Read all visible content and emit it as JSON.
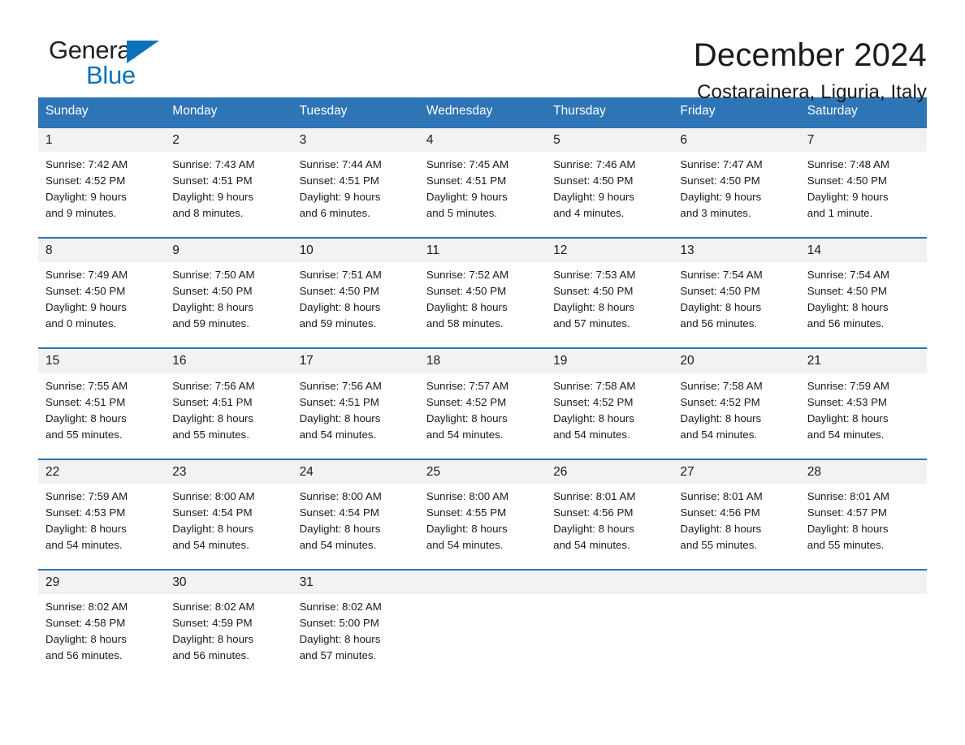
{
  "brand": {
    "logo_text_primary": "General",
    "logo_text_secondary": "Blue",
    "triangle_icon": "blue-triangle-icon",
    "accent_color": "#0d72b9"
  },
  "header": {
    "title": "December 2024",
    "subtitle": "Costarainera, Liguria, Italy"
  },
  "colors": {
    "header_blue": "#2e75b6",
    "daynum_band": "#f2f2f2",
    "text": "#1a1a1a"
  },
  "calendar": {
    "weekday_headers": [
      "Sunday",
      "Monday",
      "Tuesday",
      "Wednesday",
      "Thursday",
      "Friday",
      "Saturday"
    ],
    "weeks": [
      {
        "days": [
          {
            "num": "1",
            "sunrise": "Sunrise: 7:42 AM",
            "sunset": "Sunset: 4:52 PM",
            "daylight1": "Daylight: 9 hours",
            "daylight2": "and 9 minutes."
          },
          {
            "num": "2",
            "sunrise": "Sunrise: 7:43 AM",
            "sunset": "Sunset: 4:51 PM",
            "daylight1": "Daylight: 9 hours",
            "daylight2": "and 8 minutes."
          },
          {
            "num": "3",
            "sunrise": "Sunrise: 7:44 AM",
            "sunset": "Sunset: 4:51 PM",
            "daylight1": "Daylight: 9 hours",
            "daylight2": "and 6 minutes."
          },
          {
            "num": "4",
            "sunrise": "Sunrise: 7:45 AM",
            "sunset": "Sunset: 4:51 PM",
            "daylight1": "Daylight: 9 hours",
            "daylight2": "and 5 minutes."
          },
          {
            "num": "5",
            "sunrise": "Sunrise: 7:46 AM",
            "sunset": "Sunset: 4:50 PM",
            "daylight1": "Daylight: 9 hours",
            "daylight2": "and 4 minutes."
          },
          {
            "num": "6",
            "sunrise": "Sunrise: 7:47 AM",
            "sunset": "Sunset: 4:50 PM",
            "daylight1": "Daylight: 9 hours",
            "daylight2": "and 3 minutes."
          },
          {
            "num": "7",
            "sunrise": "Sunrise: 7:48 AM",
            "sunset": "Sunset: 4:50 PM",
            "daylight1": "Daylight: 9 hours",
            "daylight2": "and 1 minute."
          }
        ]
      },
      {
        "days": [
          {
            "num": "8",
            "sunrise": "Sunrise: 7:49 AM",
            "sunset": "Sunset: 4:50 PM",
            "daylight1": "Daylight: 9 hours",
            "daylight2": "and 0 minutes."
          },
          {
            "num": "9",
            "sunrise": "Sunrise: 7:50 AM",
            "sunset": "Sunset: 4:50 PM",
            "daylight1": "Daylight: 8 hours",
            "daylight2": "and 59 minutes."
          },
          {
            "num": "10",
            "sunrise": "Sunrise: 7:51 AM",
            "sunset": "Sunset: 4:50 PM",
            "daylight1": "Daylight: 8 hours",
            "daylight2": "and 59 minutes."
          },
          {
            "num": "11",
            "sunrise": "Sunrise: 7:52 AM",
            "sunset": "Sunset: 4:50 PM",
            "daylight1": "Daylight: 8 hours",
            "daylight2": "and 58 minutes."
          },
          {
            "num": "12",
            "sunrise": "Sunrise: 7:53 AM",
            "sunset": "Sunset: 4:50 PM",
            "daylight1": "Daylight: 8 hours",
            "daylight2": "and 57 minutes."
          },
          {
            "num": "13",
            "sunrise": "Sunrise: 7:54 AM",
            "sunset": "Sunset: 4:50 PM",
            "daylight1": "Daylight: 8 hours",
            "daylight2": "and 56 minutes."
          },
          {
            "num": "14",
            "sunrise": "Sunrise: 7:54 AM",
            "sunset": "Sunset: 4:50 PM",
            "daylight1": "Daylight: 8 hours",
            "daylight2": "and 56 minutes."
          }
        ]
      },
      {
        "days": [
          {
            "num": "15",
            "sunrise": "Sunrise: 7:55 AM",
            "sunset": "Sunset: 4:51 PM",
            "daylight1": "Daylight: 8 hours",
            "daylight2": "and 55 minutes."
          },
          {
            "num": "16",
            "sunrise": "Sunrise: 7:56 AM",
            "sunset": "Sunset: 4:51 PM",
            "daylight1": "Daylight: 8 hours",
            "daylight2": "and 55 minutes."
          },
          {
            "num": "17",
            "sunrise": "Sunrise: 7:56 AM",
            "sunset": "Sunset: 4:51 PM",
            "daylight1": "Daylight: 8 hours",
            "daylight2": "and 54 minutes."
          },
          {
            "num": "18",
            "sunrise": "Sunrise: 7:57 AM",
            "sunset": "Sunset: 4:52 PM",
            "daylight1": "Daylight: 8 hours",
            "daylight2": "and 54 minutes."
          },
          {
            "num": "19",
            "sunrise": "Sunrise: 7:58 AM",
            "sunset": "Sunset: 4:52 PM",
            "daylight1": "Daylight: 8 hours",
            "daylight2": "and 54 minutes."
          },
          {
            "num": "20",
            "sunrise": "Sunrise: 7:58 AM",
            "sunset": "Sunset: 4:52 PM",
            "daylight1": "Daylight: 8 hours",
            "daylight2": "and 54 minutes."
          },
          {
            "num": "21",
            "sunrise": "Sunrise: 7:59 AM",
            "sunset": "Sunset: 4:53 PM",
            "daylight1": "Daylight: 8 hours",
            "daylight2": "and 54 minutes."
          }
        ]
      },
      {
        "days": [
          {
            "num": "22",
            "sunrise": "Sunrise: 7:59 AM",
            "sunset": "Sunset: 4:53 PM",
            "daylight1": "Daylight: 8 hours",
            "daylight2": "and 54 minutes."
          },
          {
            "num": "23",
            "sunrise": "Sunrise: 8:00 AM",
            "sunset": "Sunset: 4:54 PM",
            "daylight1": "Daylight: 8 hours",
            "daylight2": "and 54 minutes."
          },
          {
            "num": "24",
            "sunrise": "Sunrise: 8:00 AM",
            "sunset": "Sunset: 4:54 PM",
            "daylight1": "Daylight: 8 hours",
            "daylight2": "and 54 minutes."
          },
          {
            "num": "25",
            "sunrise": "Sunrise: 8:00 AM",
            "sunset": "Sunset: 4:55 PM",
            "daylight1": "Daylight: 8 hours",
            "daylight2": "and 54 minutes."
          },
          {
            "num": "26",
            "sunrise": "Sunrise: 8:01 AM",
            "sunset": "Sunset: 4:56 PM",
            "daylight1": "Daylight: 8 hours",
            "daylight2": "and 54 minutes."
          },
          {
            "num": "27",
            "sunrise": "Sunrise: 8:01 AM",
            "sunset": "Sunset: 4:56 PM",
            "daylight1": "Daylight: 8 hours",
            "daylight2": "and 55 minutes."
          },
          {
            "num": "28",
            "sunrise": "Sunrise: 8:01 AM",
            "sunset": "Sunset: 4:57 PM",
            "daylight1": "Daylight: 8 hours",
            "daylight2": "and 55 minutes."
          }
        ]
      },
      {
        "days": [
          {
            "num": "29",
            "sunrise": "Sunrise: 8:02 AM",
            "sunset": "Sunset: 4:58 PM",
            "daylight1": "Daylight: 8 hours",
            "daylight2": "and 56 minutes."
          },
          {
            "num": "30",
            "sunrise": "Sunrise: 8:02 AM",
            "sunset": "Sunset: 4:59 PM",
            "daylight1": "Daylight: 8 hours",
            "daylight2": "and 56 minutes."
          },
          {
            "num": "31",
            "sunrise": "Sunrise: 8:02 AM",
            "sunset": "Sunset: 5:00 PM",
            "daylight1": "Daylight: 8 hours",
            "daylight2": "and 57 minutes."
          },
          {
            "num": "",
            "sunrise": "",
            "sunset": "",
            "daylight1": "",
            "daylight2": ""
          },
          {
            "num": "",
            "sunrise": "",
            "sunset": "",
            "daylight1": "",
            "daylight2": ""
          },
          {
            "num": "",
            "sunrise": "",
            "sunset": "",
            "daylight1": "",
            "daylight2": ""
          },
          {
            "num": "",
            "sunrise": "",
            "sunset": "",
            "daylight1": "",
            "daylight2": ""
          }
        ]
      }
    ]
  }
}
